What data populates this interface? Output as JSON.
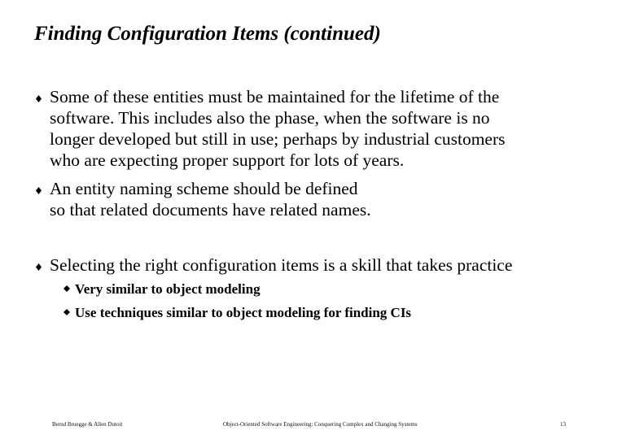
{
  "slide": {
    "title": "Finding Configuration Items (continued)",
    "bullets": [
      {
        "icon": "diamond-bullet-icon",
        "lines": [
          "Some of these entities must be maintained for the lifetime of the",
          "software. This includes also the phase, when the software is no",
          "longer developed but still in use; perhaps by industrial customers",
          "who are expecting proper support for lots of years."
        ]
      },
      {
        "icon": "diamond-bullet-icon",
        "lines": [
          "An entity naming scheme should be defined",
          "so that related documents have related names."
        ]
      },
      {
        "icon": "diamond-bullet-icon",
        "lines": [
          "Selecting the right configuration items is a skill that takes practice"
        ],
        "sub_bullets": [
          {
            "icon": "filled-diamond-bullet-icon",
            "text": "Very similar to object modeling"
          },
          {
            "icon": "filled-diamond-bullet-icon",
            "text": "Use techniques similar to object modeling for finding CIs"
          }
        ]
      }
    ],
    "footer": {
      "authors": "Bernd Bruegge & Allen Dutoit",
      "book": "Object-Oriented Software Engineering: Conquering Complex and Changing Systems",
      "page_number": "13"
    }
  }
}
